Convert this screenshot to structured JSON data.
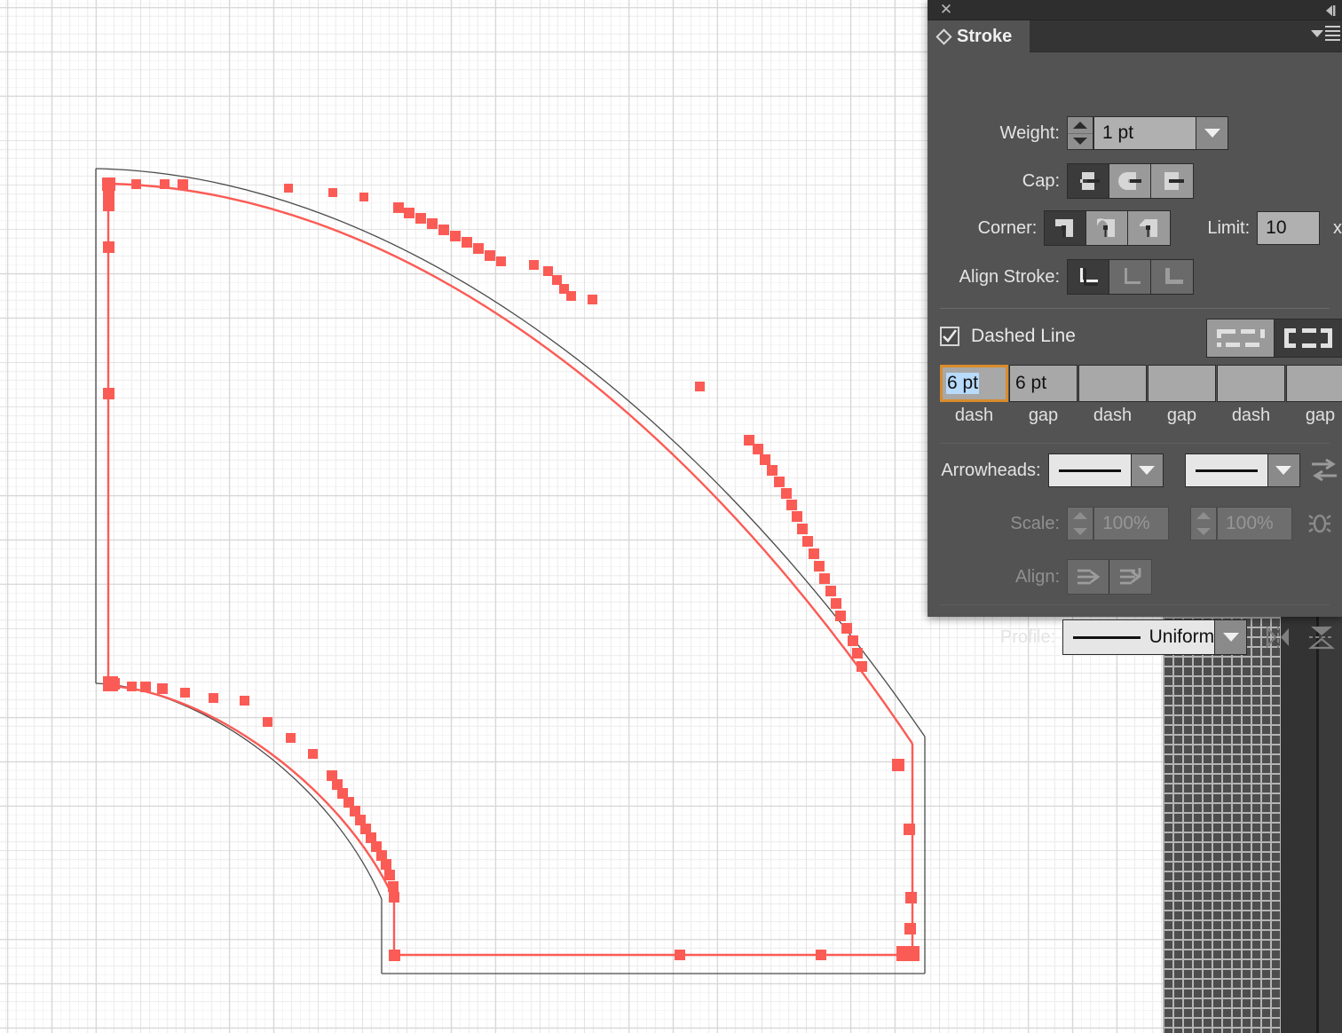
{
  "app": {
    "canvas_background": "#ffffff",
    "grid_color": "#d8d8d8"
  },
  "artwork": {
    "selection_color": "#fb5b55",
    "outline_color": "#4a4a4a",
    "description": "quarter-annulus path with red anchor points selected"
  },
  "panel": {
    "title": "Stroke",
    "close_icon": "close-icon",
    "collapse_icon": "collapse-arrow-icon",
    "menu_icon": "panel-menu-icon",
    "tab_icon": "diamond-icon",
    "weight": {
      "label": "Weight:",
      "value": "1 pt",
      "stepper_icon": "spinner-icon",
      "dropdown_icon": "chevron-down-icon"
    },
    "cap": {
      "label": "Cap:",
      "options": [
        "butt-cap",
        "round-cap",
        "projecting-cap"
      ],
      "selected_index": 0
    },
    "corner": {
      "label": "Corner:",
      "options": [
        "miter-join",
        "round-join",
        "bevel-join"
      ],
      "selected_index": 0
    },
    "limit": {
      "label": "Limit:",
      "value": "10",
      "unit": "x"
    },
    "align_stroke": {
      "label": "Align Stroke:",
      "options": [
        "align-center",
        "align-inside",
        "align-outside"
      ],
      "selected_index": 0,
      "disabled": true
    },
    "dashed_line": {
      "label": "Dashed Line",
      "checked": true,
      "checkbox_icon": "checkmark-icon",
      "dash_presets": [
        "preserve-exact-dash-icon",
        "adjust-dashes-to-corners-icon"
      ],
      "preset_selected_index": 1,
      "fields": [
        {
          "value": "6 pt",
          "label": "dash",
          "focused": true,
          "selected": true
        },
        {
          "value": "6 pt",
          "label": "gap",
          "focused": false,
          "selected": false
        },
        {
          "value": "",
          "label": "dash",
          "focused": false,
          "selected": false
        },
        {
          "value": "",
          "label": "gap",
          "focused": false,
          "selected": false
        },
        {
          "value": "",
          "label": "dash",
          "focused": false,
          "selected": false
        },
        {
          "value": "",
          "label": "gap",
          "focused": false,
          "selected": false
        }
      ]
    },
    "arrowheads": {
      "label": "Arrowheads:",
      "start_value": "none-arrowhead",
      "end_value": "none-arrowhead",
      "swap_icon": "swap-arrowheads-icon",
      "dropdown_icon": "chevron-down-icon"
    },
    "scale": {
      "label": "Scale:",
      "start_value": "100%",
      "end_value": "100%",
      "link_icon": "link-scales-icon",
      "disabled": true
    },
    "align_arrow": {
      "label": "Align:",
      "options": [
        "extend-arrow-beyond-end",
        "place-arrow-at-end"
      ],
      "disabled": true
    },
    "profile": {
      "label": "Profile:",
      "value": "Uniform",
      "dropdown_icon": "chevron-down-icon",
      "flip_across_icon": "flip-across-icon",
      "flip_along_icon": "flip-along-icon"
    }
  }
}
